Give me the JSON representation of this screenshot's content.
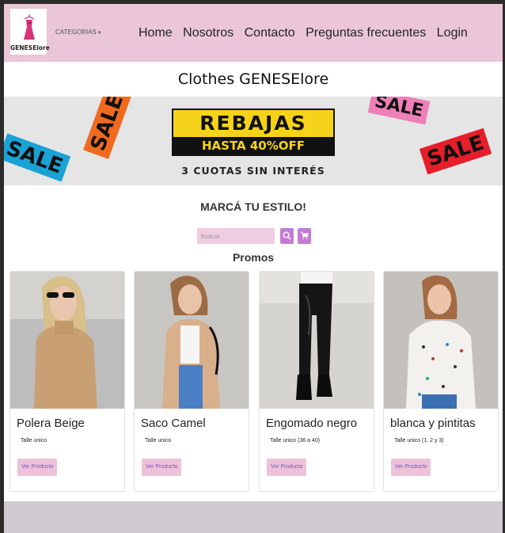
{
  "brand": {
    "logo_text": "GENESElore",
    "logo_icon": "dress-hanger-icon"
  },
  "nav": {
    "categories_label": "CATEGORIAS",
    "links": [
      {
        "label": "Home"
      },
      {
        "label": "Nosotros"
      },
      {
        "label": "Contacto"
      },
      {
        "label": "Preguntas frecuentes"
      },
      {
        "label": "Login"
      }
    ]
  },
  "page": {
    "title": "Clothes GENESElore",
    "slogan": "MARCÁ TU ESTILO!",
    "promos_title": "Promos"
  },
  "banner": {
    "headline": "REBAJAS",
    "subline": "HASTA 40%OFF",
    "installments": "3 CUOTAS SIN INTERÉS",
    "tag_text": "SALE"
  },
  "search": {
    "placeholder": "buscar",
    "value": "",
    "search_icon": "search-icon",
    "cart_icon": "cart-icon"
  },
  "products": [
    {
      "name": "Polera Beige",
      "size": "Talle unico",
      "button": "Ver Producto"
    },
    {
      "name": "Saco Camel",
      "size": "Talle unico",
      "button": "Ver Producto"
    },
    {
      "name": "Engomado negro",
      "size": "Talle unico (36 a 40)",
      "button": "Ver Producto"
    },
    {
      "name": "blanca y pintitas",
      "size": "Talle unico (1, 2 y 3)",
      "button": "Ver Producto"
    }
  ],
  "colors": {
    "navbar": "#ebc6d8",
    "accent": "#c47ad6",
    "button": "#edc2d8",
    "banner_yellow": "#f6d31b"
  }
}
